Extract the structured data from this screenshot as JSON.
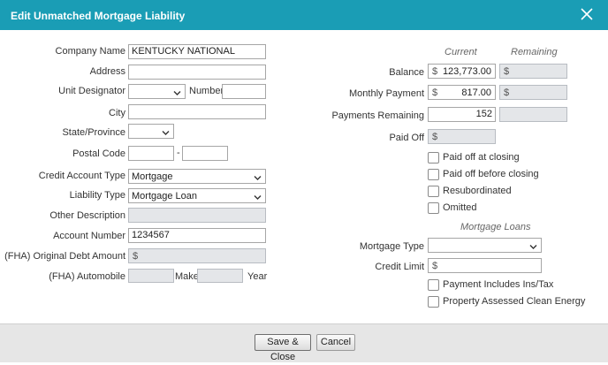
{
  "dialog": {
    "title": "Edit Unmatched Mortgage Liability"
  },
  "icons": {
    "close": "close-icon",
    "chevron": "chevron-down-icon"
  },
  "colors": {
    "titlebar": "#1a9db5",
    "disabled_field": "#e4e6e9",
    "footer": "#e6e6e6"
  },
  "left": {
    "company_name_label": "Company Name",
    "company_name_value": "KENTUCKY NATIONAL",
    "address_label": "Address",
    "unit_designator_label": "Unit Designator",
    "number_label": "Number",
    "city_label": "City",
    "state_label": "State/Province",
    "postal_code_label": "Postal Code",
    "postal_sep": "-",
    "credit_account_type_label": "Credit Account Type",
    "credit_account_type_value": "Mortgage",
    "liability_type_label": "Liability Type",
    "liability_type_value": "Mortgage Loan",
    "other_description_label": "Other Description",
    "account_number_label": "Account Number",
    "account_number_value": "1234567",
    "fha_debt_label": "(FHA) Original Debt Amount",
    "currency": "$",
    "fha_auto_label": "(FHA) Automobile",
    "make_label": "Make",
    "year_label": "Year"
  },
  "right": {
    "current_header": "Current",
    "remaining_header": "Remaining",
    "balance_label": "Balance",
    "balance_value": "123,773.00",
    "monthly_payment_label": "Monthly Payment",
    "monthly_payment_value": "817.00",
    "payments_remaining_label": "Payments Remaining",
    "payments_remaining_value": "152",
    "paid_off_label": "Paid Off",
    "currency": "$",
    "checks": {
      "paid_off_at_closing": "Paid off at closing",
      "paid_off_before_closing": "Paid off before closing",
      "resubordinated": "Resubordinated",
      "omitted": "Omitted"
    },
    "mortgage_loans_header": "Mortgage Loans",
    "mortgage_type_label": "Mortgage Type",
    "credit_limit_label": "Credit Limit",
    "payment_includes_label": "Payment Includes Ins/Tax",
    "pace_label": "Property Assessed Clean Energy"
  },
  "footer": {
    "save_close": "Save & Close",
    "cancel": "Cancel"
  }
}
